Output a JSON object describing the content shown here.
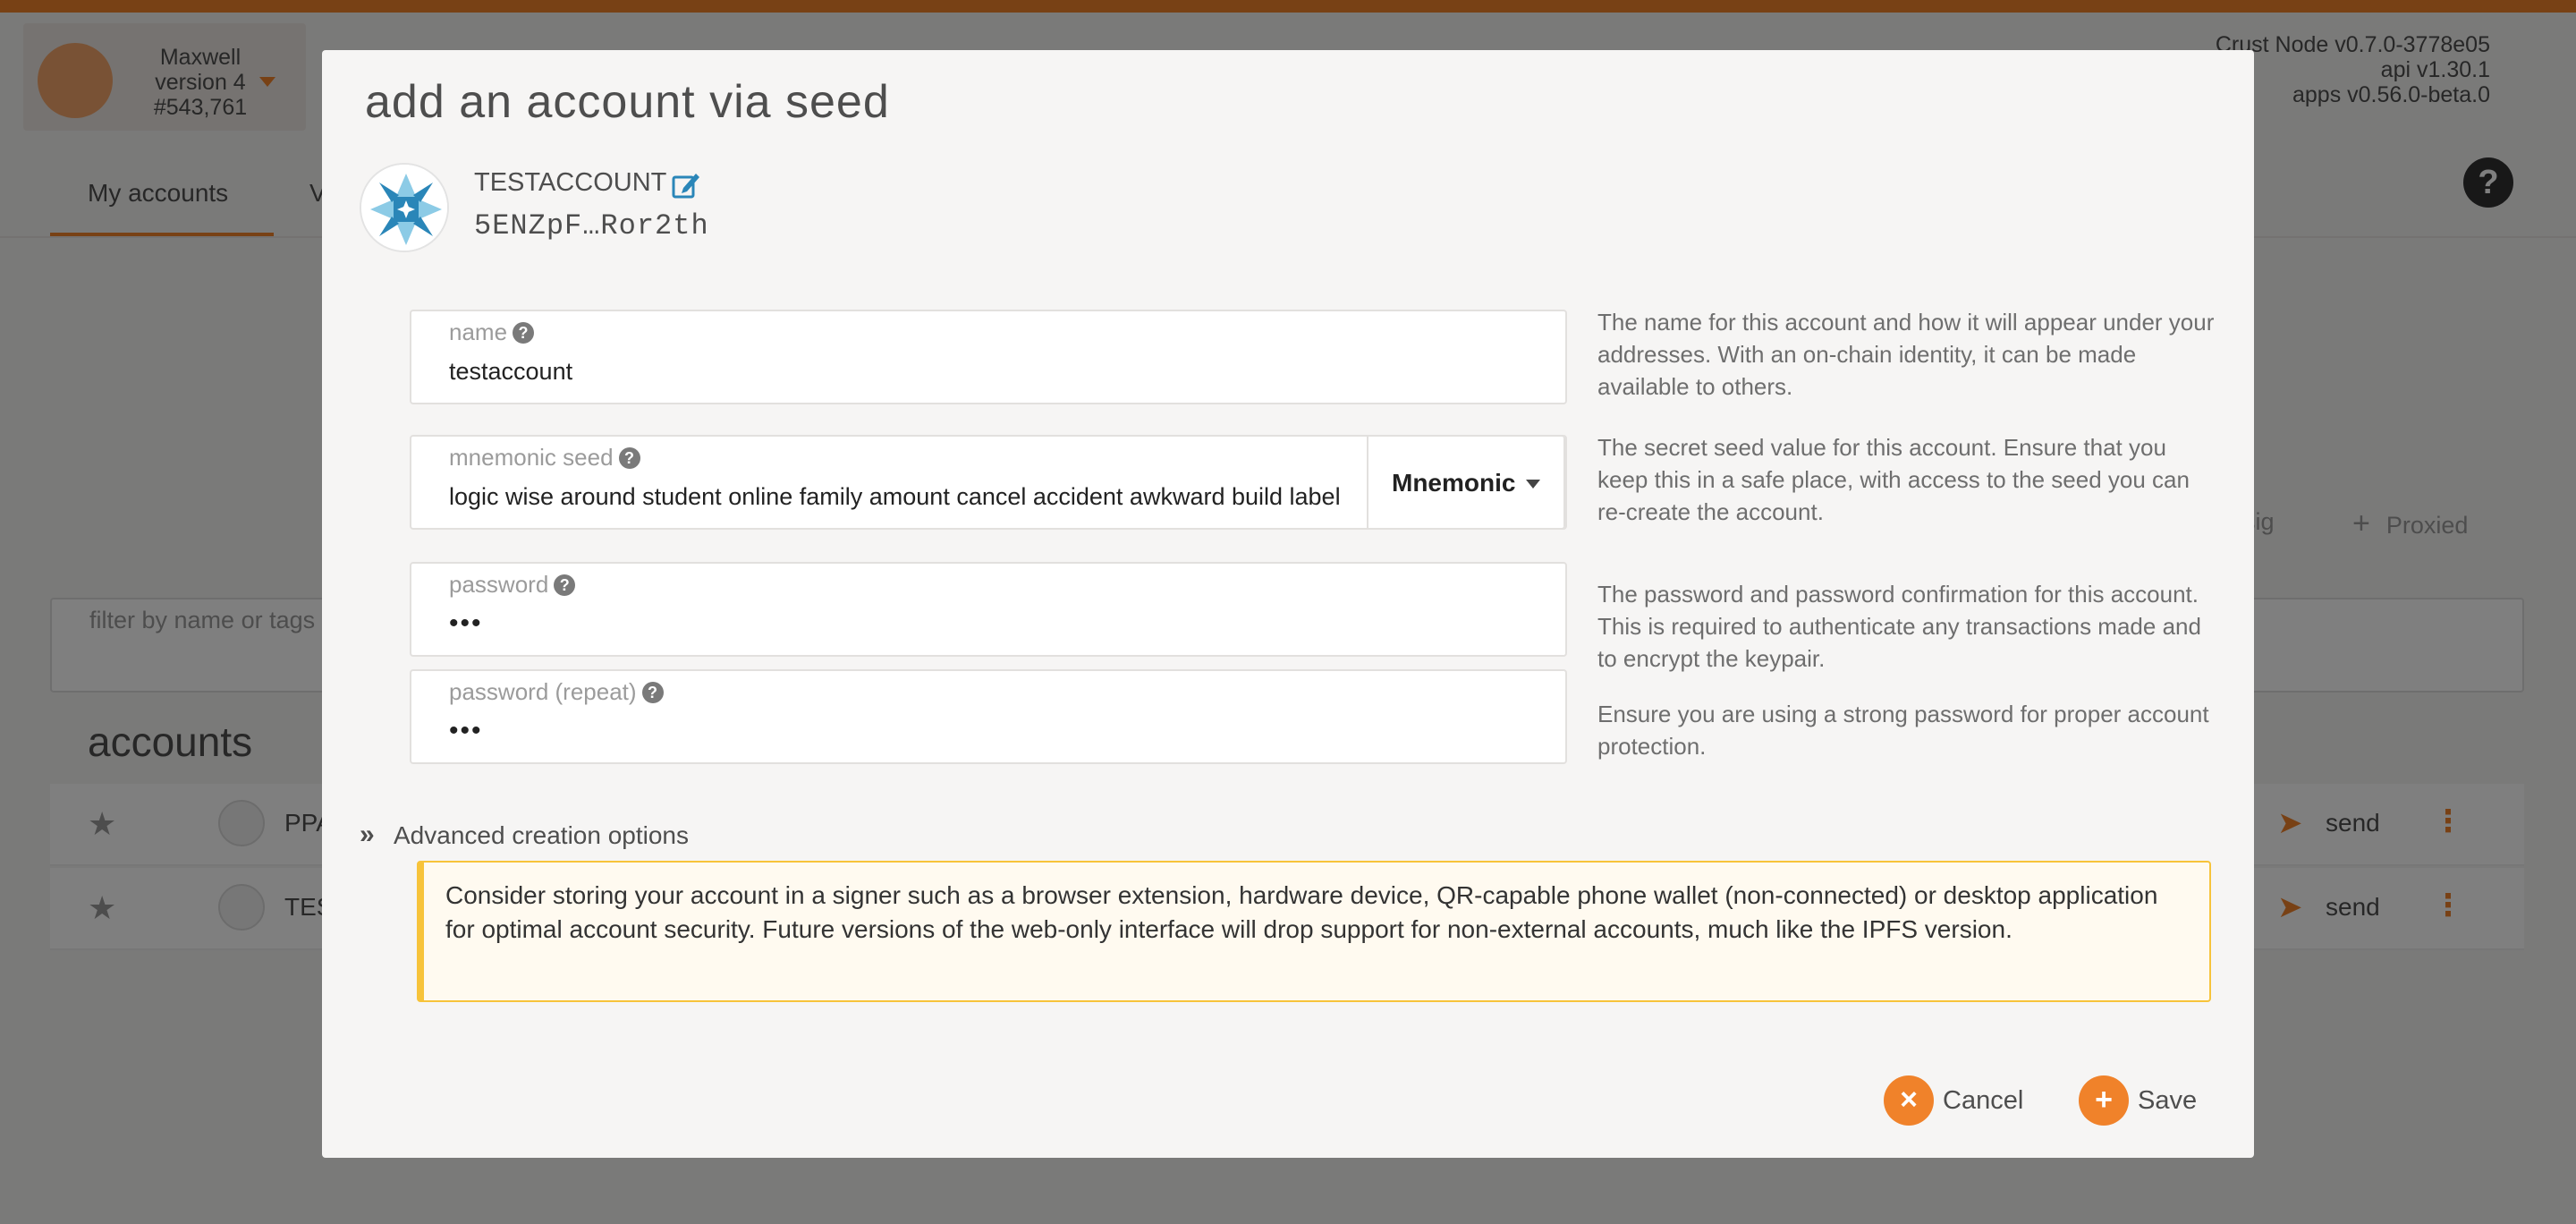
{
  "chain": {
    "name": "Maxwell",
    "version": "version 4",
    "block": "#543,761"
  },
  "node_info": {
    "node": "Crust Node v0.7.0-3778e05",
    "api": "api v1.30.1",
    "apps": "apps v0.56.0-beta.0"
  },
  "tabs": {
    "active": "My accounts",
    "next_partial": "V"
  },
  "background": {
    "sig_partial": "sig",
    "proxied": "Proxied",
    "filter_placeholder": "filter by name or tags",
    "accounts_title": "accounts",
    "rows": [
      {
        "name": "PPA",
        "send": "send"
      },
      {
        "name": "TES",
        "send": "send"
      }
    ]
  },
  "modal": {
    "title": "add an account via seed",
    "account_name": "TESTACCOUNT",
    "address": "5ENZpF…Ror2th",
    "name_field": {
      "label": "name",
      "value": "testaccount",
      "help": "The name for this account and how it will appear under your addresses. With an on-chain identity, it can be made available to others."
    },
    "seed_field": {
      "label": "mnemonic seed",
      "value": "logic wise around student online family amount cancel accident awkward build label",
      "type": "Mnemonic",
      "help": "The secret seed value for this account. Ensure that you keep this in a safe place, with access to the seed you can re-create the account."
    },
    "password_field": {
      "label": "password",
      "value": "•••",
      "help": "The password and password confirmation for this account. This is required to authenticate any transactions made and to encrypt the keypair."
    },
    "password_repeat_field": {
      "label": "password (repeat)",
      "value": "•••",
      "help": "Ensure you are using a strong password for proper account protection."
    },
    "advanced_label": "Advanced creation options",
    "warning": "Consider storing your account in a signer such as a browser extension, hardware device, QR-capable phone wallet (non-connected) or desktop application for optimal account security. Future versions of the web-only interface will drop support for non-external accounts, much like the IPFS version.",
    "cancel_label": "Cancel",
    "save_label": "Save"
  },
  "colors": {
    "accent": "#f0822a",
    "warning_border": "#f7c33a",
    "warning_bg": "#fffaf0",
    "identicon_blue": "#2a86b8"
  }
}
